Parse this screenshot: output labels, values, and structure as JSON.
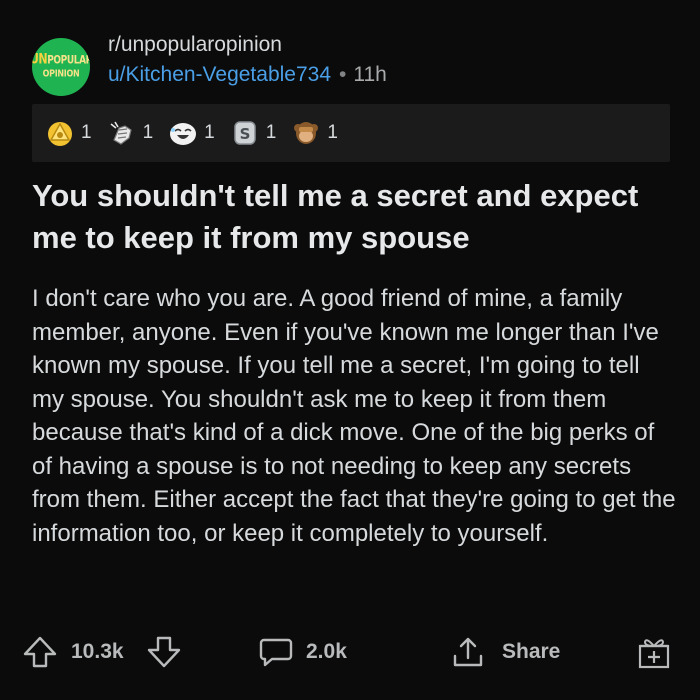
{
  "post": {
    "subreddit": "r/unpopularopinion",
    "logo": {
      "line1_big": "UN",
      "line1_rest": "POPULAR",
      "line2": "OPINION"
    },
    "author": "u/Kitchen-Vegetable734",
    "separator": "•",
    "age": "11h",
    "title": "You shouldn't tell me a secret and expect me to keep it from my spouse",
    "body": "I don't care who you are. A good friend of mine, a family member, anyone. Even if you've known me longer than I've known my spouse. If you tell me a secret, I'm going to tell my spouse. You shouldn't ask me to keep it from them because that's kind of a dick move. One of the big perks of of having a spouse is to not needing to keep any secrets from them. Either accept the fact that they're going to get the information too, or keep it completely to yourself."
  },
  "awards": [
    {
      "icon": "gold-award-icon",
      "count": "1"
    },
    {
      "icon": "fist-award-icon",
      "count": "1"
    },
    {
      "icon": "laughing-face-award-icon",
      "count": "1"
    },
    {
      "icon": "silver-coin-award-icon",
      "count": "1"
    },
    {
      "icon": "monkey-award-icon",
      "count": "1"
    }
  ],
  "actions": {
    "upvote_icon": "upvote-arrow-icon",
    "score": "10.3k",
    "downvote_icon": "downvote-arrow-icon",
    "comment_icon": "comment-bubble-icon",
    "comments": "2.0k",
    "share_icon": "share-upload-icon",
    "share_label": "Share",
    "award_icon": "gift-award-icon"
  },
  "colors": {
    "background": "#0b0b0b",
    "award_bar": "#1b1b1c",
    "username": "#4a9fe6",
    "subreddit_logo": "#1fb451",
    "text": "#d7dadc"
  }
}
